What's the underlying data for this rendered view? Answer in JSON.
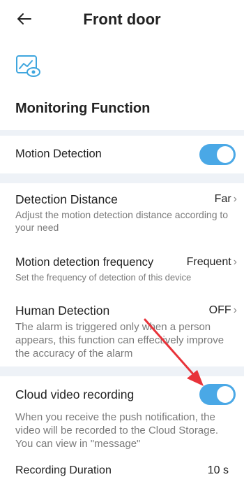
{
  "header": {
    "title": "Front door"
  },
  "section": {
    "title": "Monitoring Function"
  },
  "rows": {
    "motion_detection": {
      "label": "Motion Detection",
      "enabled": true
    },
    "detection_distance": {
      "label": "Detection Distance",
      "value": "Far",
      "description": "Adjust the motion detection distance according to your need"
    },
    "motion_frequency": {
      "label": "Motion detection frequency",
      "value": "Frequent",
      "description": "Set the frequency of detection of this device"
    },
    "human_detection": {
      "label": "Human Detection",
      "value": "OFF",
      "description": "The alarm is triggered only when a person appears, this function can effectively improve the accuracy of the alarm"
    },
    "cloud_recording": {
      "label": "Cloud video recording",
      "enabled": true,
      "description": "When you receive the push notification, the video will be recorded to the Cloud Storage. You can view in \"message\""
    },
    "recording_duration": {
      "label": "Recording Duration",
      "value": "10 s"
    }
  },
  "colors": {
    "accent": "#4aa8e6",
    "separator": "#eef2f7",
    "annotation_arrow": "#e8333a"
  }
}
